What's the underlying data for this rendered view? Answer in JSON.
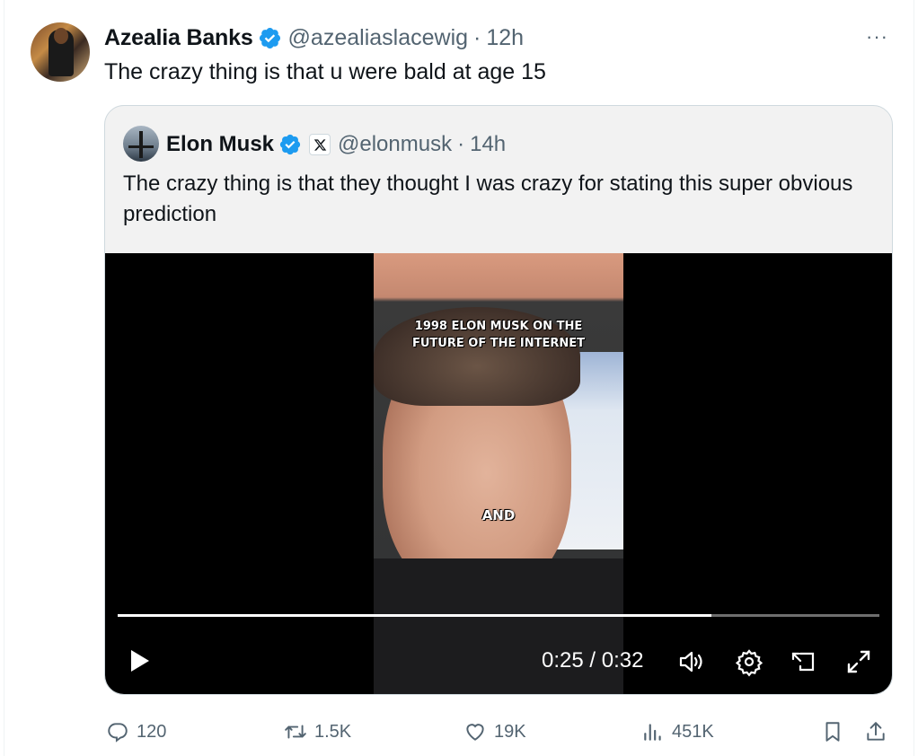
{
  "tweet": {
    "author_name": "Azealia Banks",
    "handle": "@azealiaslacewig",
    "separator": "·",
    "time": "12h",
    "more": "···",
    "text": "The crazy thing is that u were bald at age 15"
  },
  "quoted": {
    "author_name": "Elon Musk",
    "handle": "@elonmusk",
    "separator": "·",
    "time": "14h",
    "text": "The crazy thing is that they thought I was crazy for stating this super obvious prediction",
    "video": {
      "caption_top_line1": "1998 ELON MUSK ON THE",
      "caption_top_line2": "FUTURE OF THE INTERNET",
      "caption_subtitle": "AND",
      "time_display": "0:25 / 0:32",
      "progress_fraction": 0.78
    }
  },
  "actions": {
    "replies": "120",
    "reposts": "1.5K",
    "likes": "19K",
    "views": "451K"
  },
  "colors": {
    "verified_blue": "#1d9bf0",
    "secondary_text": "#536471",
    "border": "#cfd9de"
  },
  "icons": [
    "verified-badge-icon",
    "more-icon",
    "x-affiliate-icon",
    "play-icon",
    "volume-icon",
    "settings-icon",
    "picture-in-picture-icon",
    "fullscreen-icon",
    "reply-icon",
    "repost-icon",
    "like-icon",
    "views-icon",
    "bookmark-icon",
    "share-icon"
  ]
}
